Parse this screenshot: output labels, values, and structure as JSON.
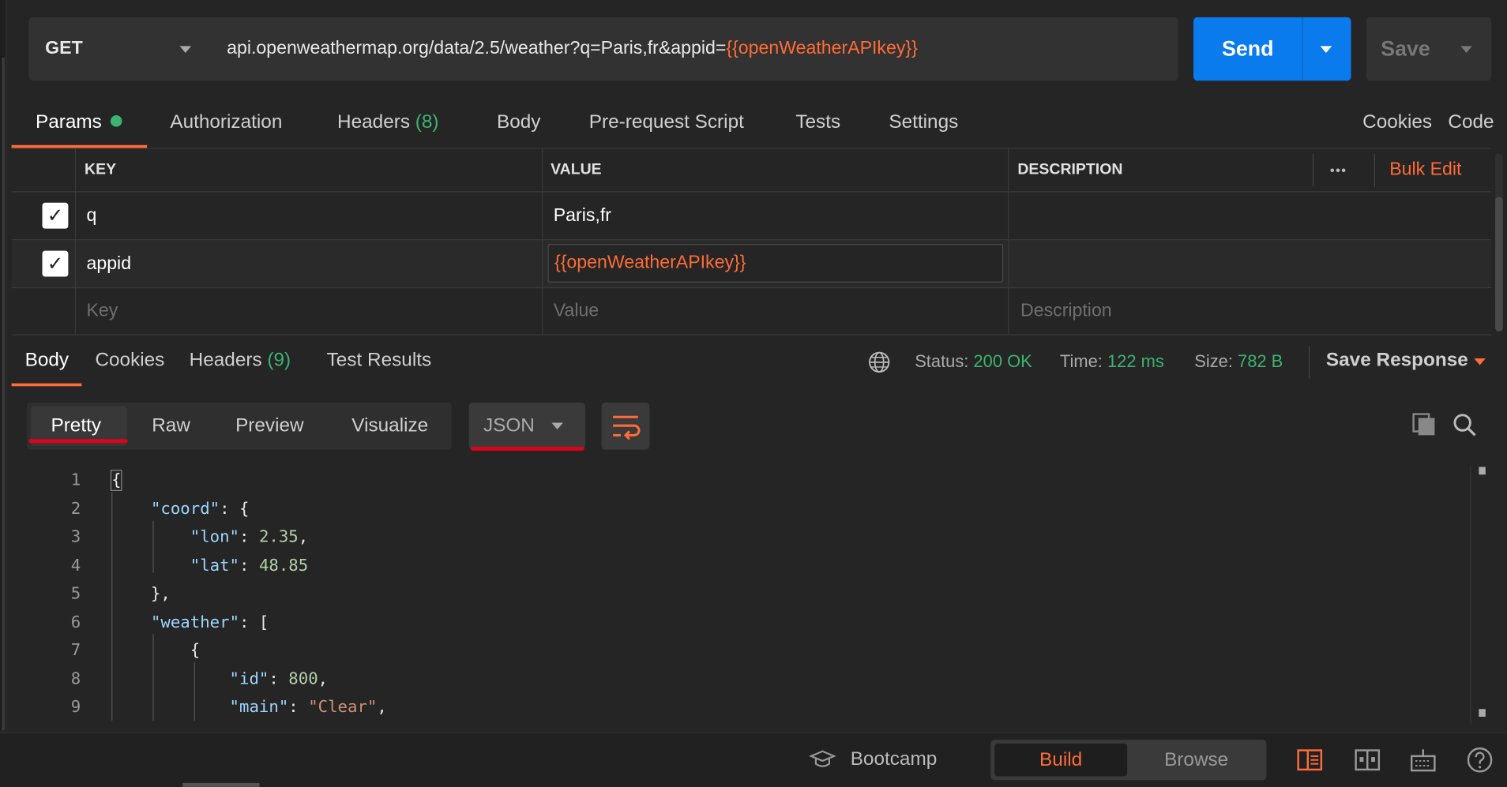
{
  "request": {
    "method": "GET",
    "url_base": "api.openweathermap.org/data/2.5/weather?q=Paris,fr&appid=",
    "url_var": "{{openWeatherAPIkey}}",
    "send_label": "Send",
    "save_label": "Save"
  },
  "request_tabs": {
    "params": "Params",
    "authorization": "Authorization",
    "headers": "Headers",
    "headers_count": "(8)",
    "body": "Body",
    "prerequest": "Pre-request Script",
    "tests": "Tests",
    "settings": "Settings",
    "cookies": "Cookies",
    "code": "Code"
  },
  "params_table": {
    "col_key": "KEY",
    "col_value": "VALUE",
    "col_description": "DESCRIPTION",
    "more": "•••",
    "bulk_edit": "Bulk Edit",
    "rows": [
      {
        "key": "q",
        "value": "Paris,fr",
        "checked": true
      },
      {
        "key": "appid",
        "value": "{{openWeatherAPIkey}}",
        "checked": true
      }
    ],
    "placeholder_key": "Key",
    "placeholder_value": "Value",
    "placeholder_description": "Description"
  },
  "response_tabs": {
    "body": "Body",
    "cookies": "Cookies",
    "headers": "Headers",
    "headers_count": "(9)",
    "test_results": "Test Results"
  },
  "response_meta": {
    "status_label": "Status:",
    "status_value": "200 OK",
    "time_label": "Time:",
    "time_value": "122 ms",
    "size_label": "Size:",
    "size_value": "782 B",
    "save_response": "Save Response"
  },
  "view_modes": {
    "pretty": "Pretty",
    "raw": "Raw",
    "preview": "Preview",
    "visualize": "Visualize",
    "format": "JSON"
  },
  "code_lines": [
    "1",
    "2",
    "3",
    "4",
    "5",
    "6",
    "7",
    "8",
    "9"
  ],
  "footer": {
    "bootcamp": "Bootcamp",
    "build": "Build",
    "browse": "Browse"
  },
  "colors": {
    "accent": "#ff6c37",
    "send": "#097bed",
    "success": "#3cb371"
  }
}
